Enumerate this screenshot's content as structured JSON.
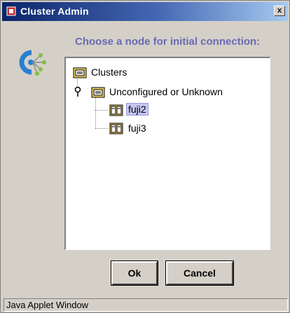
{
  "window": {
    "title": "Cluster Admin",
    "close_glyph": "x"
  },
  "dialog": {
    "heading": "Choose a node for initial connection:"
  },
  "tree": {
    "root": {
      "label": "Clusters",
      "icon": "folder-icon"
    },
    "group": {
      "label": "Unconfigured or Unknown",
      "icon": "folder-icon",
      "expanded": true
    },
    "nodes": [
      {
        "label": "fuji2",
        "icon": "server-icon",
        "selected": true
      },
      {
        "label": "fuji3",
        "icon": "server-icon",
        "selected": false
      }
    ]
  },
  "buttons": {
    "ok_label": "Ok",
    "cancel_label": "Cancel"
  },
  "status": {
    "text": "Java Applet Window"
  },
  "colors": {
    "heading": "#6a6ab4",
    "selection": "#c6c6f2",
    "titlebar_start": "#0a246a",
    "titlebar_end": "#a6caf0"
  }
}
